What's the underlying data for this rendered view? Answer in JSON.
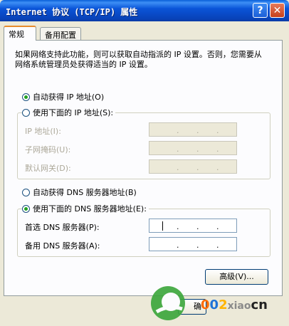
{
  "window": {
    "title": "Internet 协议 (TCP/IP) 属性"
  },
  "tabs": [
    {
      "label": "常规"
    },
    {
      "label": "备用配置"
    }
  ],
  "intro_text": "如果网络支持此功能，则可以获取自动指派的 IP 设置。否则，您需要从网络系统管理员处获得适当的 IP 设置。",
  "ip_section": {
    "auto_label": "自动获得 IP 地址(O)",
    "auto_selected": true,
    "manual_label": "使用下面的 IP 地址(S):",
    "manual_selected": false,
    "fields": [
      {
        "label": "IP 地址(I):",
        "value": ". . ."
      },
      {
        "label": "子网掩码(U):",
        "value": ". . ."
      },
      {
        "label": "默认网关(D):",
        "value": ". . ."
      }
    ]
  },
  "dns_section": {
    "auto_label": "自动获得 DNS 服务器地址(B)",
    "auto_selected": false,
    "manual_label": "使用下面的 DNS 服务器地址(E):",
    "manual_selected": true,
    "fields": [
      {
        "label": "首选 DNS 服务器(P):",
        "value": ". . ."
      },
      {
        "label": "备用 DNS 服务器(A):",
        "value": ". . ."
      }
    ]
  },
  "buttons": {
    "advanced": "高级(V)...",
    "ok": "确"
  },
  "watermark": {
    "text": "cn"
  }
}
